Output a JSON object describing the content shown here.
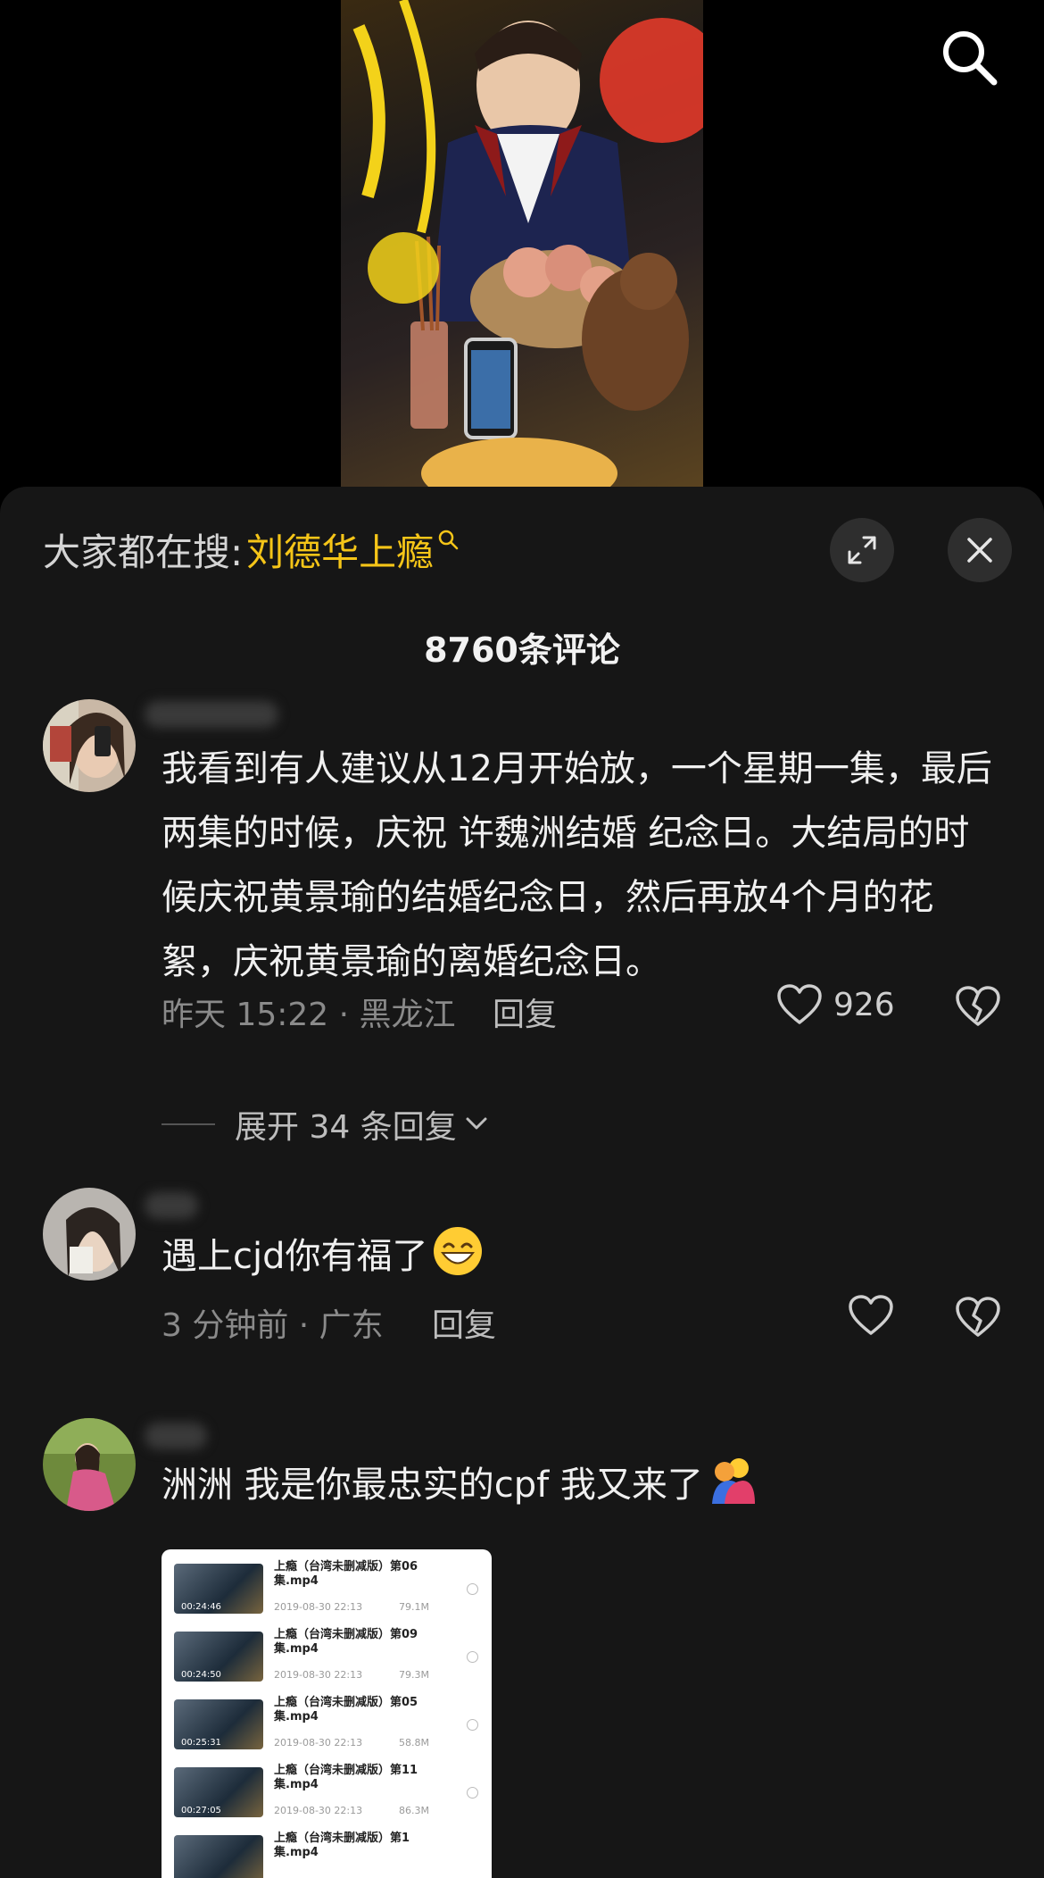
{
  "header": {
    "search_icon": "search-icon"
  },
  "hot_search": {
    "prefix": "大家都在搜:",
    "term": "刘德华上瘾"
  },
  "comment_count": "8760条评论",
  "comments": [
    {
      "text": "我看到有人建议从12月开始放，一个星期一集，最后两集的时候，庆祝 许魏洲结婚 纪念日。大结局的时候庆祝黄景瑜的结婚纪念日，然后再放4个月的花絮，庆祝黄景瑜的离婚纪念日。",
      "meta": "昨天 15:22 · 黑龙江",
      "reply_label": "回复",
      "like_count": "926",
      "expand_replies": "展开 34 条回复"
    },
    {
      "text": "遇上cjd你有福了",
      "meta": "3 分钟前 · 广东",
      "reply_label": "回复"
    },
    {
      "text": "洲洲 我是你最忠实的cpf  我又来了",
      "files": [
        {
          "name": "上瘾（台湾未删减版）第06集.mp4",
          "date": "2019-08-30 22:13",
          "size": "79.1M",
          "duration": "00:24:46"
        },
        {
          "name": "上瘾（台湾未删减版）第09集.mp4",
          "date": "2019-08-30 22:13",
          "size": "79.3M",
          "duration": "00:24:50"
        },
        {
          "name": "上瘾（台湾未删减版）第05集.mp4",
          "date": "2019-08-30 22:13",
          "size": "58.8M",
          "duration": "00:25:31"
        },
        {
          "name": "上瘾（台湾未删减版）第11集.mp4",
          "date": "2019-08-30 22:13",
          "size": "86.3M",
          "duration": "00:27:05"
        },
        {
          "name": "上瘾（台湾未删减版）第1集.mp4",
          "date": "",
          "size": "",
          "duration": ""
        }
      ]
    }
  ],
  "colors": {
    "sheet_bg": "#161616",
    "accent_yellow": "#f5c518",
    "text_primary": "#f0f0f0",
    "text_secondary": "#8a8a8a"
  }
}
